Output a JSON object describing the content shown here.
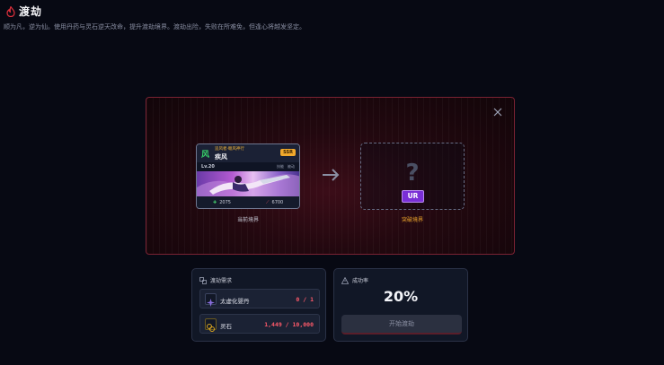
{
  "header": {
    "title": "渡劫",
    "subtitle": "顺为凡，逆为仙。使用丹药与灵石逆天改命，提升渡劫境界。渡劫出险，失败在所难免，但逢心将越发坚定。",
    "icon": "flame-icon",
    "accent": "#e0303c"
  },
  "modal": {
    "current_card": {
      "glyph": "风",
      "tag": "追风者·翱风神行",
      "name": "疾风",
      "rank": "SSR",
      "level": "Lv.20",
      "tags": [
        "技能",
        "被动"
      ],
      "hp": "2075",
      "atk": "6700"
    },
    "current_caption": "当前境界",
    "target": {
      "symbol": "?",
      "rarity": "UR"
    },
    "target_caption": "突破境界",
    "border_color": "#7a2233",
    "ur_color": "#7a2fd6",
    "ssr_color": "#f0a82c"
  },
  "requirements": {
    "heading": "渡劫需求",
    "items": [
      {
        "name": "太虚化婴丹",
        "count": "0 / 1",
        "icon": "pill-icon"
      },
      {
        "name": "灵石",
        "count": "1,449 / 10,000",
        "icon": "spirit-stone-icon"
      }
    ]
  },
  "success": {
    "heading": "成功率",
    "rate": "20%",
    "button": "开始渡劫"
  }
}
